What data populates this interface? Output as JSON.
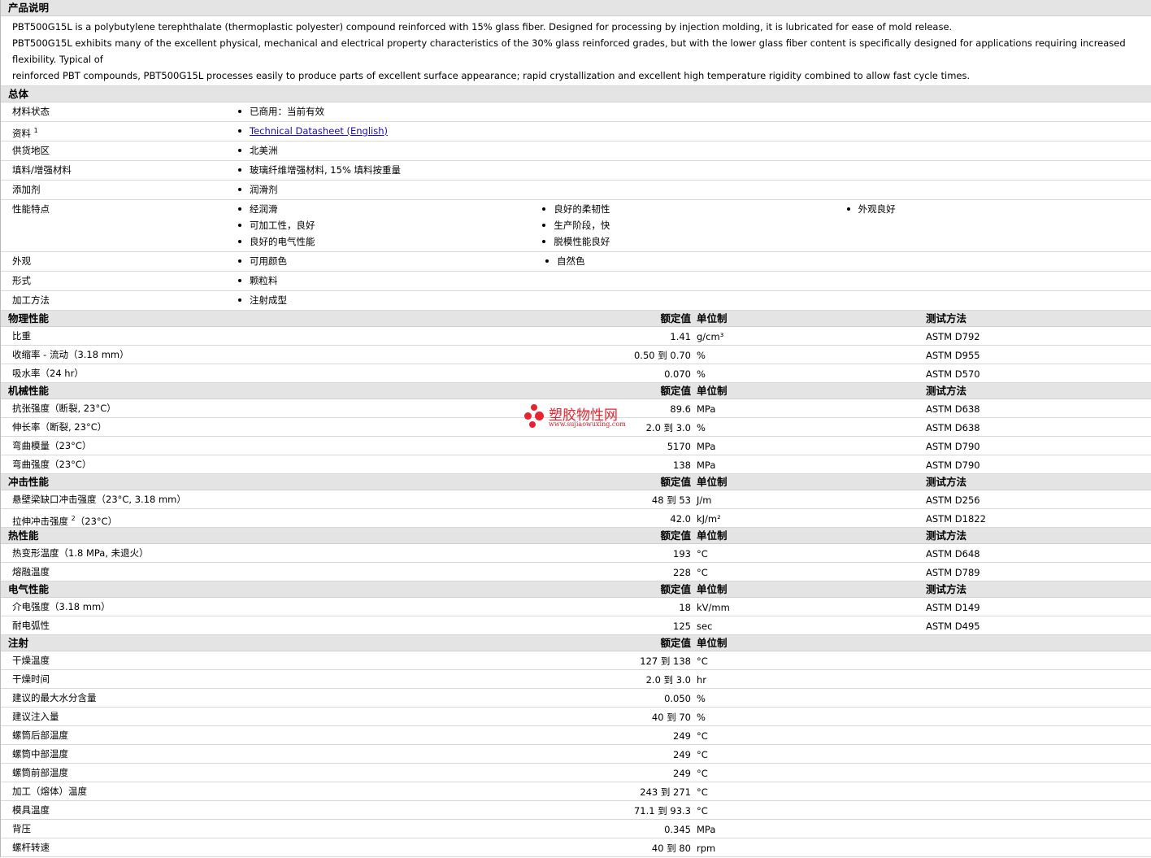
{
  "desc": {
    "title": "产品说明",
    "lines": [
      "PBT500G15L is a polybutylene terephthalate (thermoplastic polyester) compound reinforced with 15% glass fiber. Designed for processing by injection molding, it is lubricated for ease of mold release.",
      "PBT500G15L exhibits many of the excellent physical, mechanical and electrical property characteristics of the 30% glass reinforced grades, but with the lower glass fiber content is specifically designed for applications requiring increased flexibility. Typical of",
      "reinforced PBT compounds, PBT500G15L processes easily to produce parts of excellent surface appearance; rapid crystallization and excellent high temperature rigidity combined to allow fast cycle times."
    ]
  },
  "general": {
    "title": "总体",
    "rows": [
      {
        "label": "材料状态",
        "cols": [
          [
            "已商用：当前有效"
          ]
        ]
      },
      {
        "label": "资料",
        "sup": "1",
        "link": "Technical Datasheet (English)"
      },
      {
        "label": "供货地区",
        "cols": [
          [
            "北美洲"
          ]
        ]
      },
      {
        "label": "填料/增强材料",
        "cols": [
          [
            "玻璃纤维增强材料, 15% 填料按重量"
          ]
        ]
      },
      {
        "label": "添加剂",
        "cols": [
          [
            "润滑剂"
          ]
        ]
      },
      {
        "label": "性能特点",
        "cols": [
          [
            "经润滑",
            "可加工性，良好",
            "良好的电气性能"
          ],
          [
            "良好的柔韧性",
            "生产阶段，快",
            "脱模性能良好"
          ],
          [
            "外观良好"
          ]
        ]
      },
      {
        "label": "外观",
        "cols": [
          [
            "可用颜色"
          ],
          [
            "自然色"
          ]
        ]
      },
      {
        "label": "形式",
        "cols": [
          [
            "颗粒料"
          ]
        ]
      },
      {
        "label": "加工方法",
        "cols": [
          [
            "注射成型"
          ]
        ]
      }
    ]
  },
  "headers": {
    "value": "额定值",
    "unit": "单位制",
    "test": "测试方法"
  },
  "sections": [
    {
      "title": "物理性能",
      "showTest": true,
      "rows": [
        {
          "label": "比重",
          "value": "1.41",
          "unit": "g/cm³",
          "test": "ASTM D792"
        },
        {
          "label": "收缩率 - 流动（3.18 mm）",
          "value": "0.50 到  0.70",
          "unit": "%",
          "test": "ASTM D955"
        },
        {
          "label": "吸水率（24 hr）",
          "value": "0.070",
          "unit": "%",
          "test": "ASTM D570"
        }
      ]
    },
    {
      "title": "机械性能",
      "showTest": true,
      "rows": [
        {
          "label": "抗张强度（断裂, 23°C）",
          "value": "89.6",
          "unit": "MPa",
          "test": "ASTM D638"
        },
        {
          "label": "伸长率（断裂, 23°C）",
          "value": "2.0 到  3.0",
          "unit": "%",
          "test": "ASTM D638"
        },
        {
          "label": "弯曲模量（23°C）",
          "value": "5170",
          "unit": "MPa",
          "test": "ASTM D790"
        },
        {
          "label": "弯曲强度（23°C）",
          "value": "138",
          "unit": "MPa",
          "test": "ASTM D790"
        }
      ]
    },
    {
      "title": "冲击性能",
      "showTest": true,
      "rows": [
        {
          "label": "悬壁梁缺口冲击强度（23°C, 3.18 mm）",
          "value": "48 到  53",
          "unit": "J/m",
          "test": "ASTM D256"
        },
        {
          "label": "拉伸冲击强度",
          "sup": "2",
          "labelTail": "（23°C）",
          "value": "42.0",
          "unit": "kJ/m²",
          "test": "ASTM D1822"
        }
      ]
    },
    {
      "title": "热性能",
      "showTest": true,
      "rows": [
        {
          "label": "热变形温度（1.8 MPa, 未退火）",
          "value": "193",
          "unit": "°C",
          "test": "ASTM D648"
        },
        {
          "label": "熔融温度",
          "value": "228",
          "unit": "°C",
          "test": "ASTM D789"
        }
      ]
    },
    {
      "title": "电气性能",
      "showTest": true,
      "rows": [
        {
          "label": "介电强度（3.18 mm）",
          "value": "18",
          "unit": "kV/mm",
          "test": "ASTM D149"
        },
        {
          "label": "耐电弧性",
          "value": "125",
          "unit": "sec",
          "test": "ASTM D495"
        }
      ]
    },
    {
      "title": "注射",
      "showTest": false,
      "rows": [
        {
          "label": "干燥温度",
          "value": "127 到  138",
          "unit": "°C",
          "test": ""
        },
        {
          "label": "干燥时间",
          "value": "2.0 到  3.0",
          "unit": "hr",
          "test": ""
        },
        {
          "label": "建议的最大水分含量",
          "value": "0.050",
          "unit": "%",
          "test": ""
        },
        {
          "label": "建议注入量",
          "value": "40 到  70",
          "unit": "%",
          "test": ""
        },
        {
          "label": "螺筒后部温度",
          "value": "249",
          "unit": "°C",
          "test": ""
        },
        {
          "label": "螺筒中部温度",
          "value": "249",
          "unit": "°C",
          "test": ""
        },
        {
          "label": "螺筒前部温度",
          "value": "249",
          "unit": "°C",
          "test": ""
        },
        {
          "label": "加工（熔体）温度",
          "value": "243 到  271",
          "unit": "°C",
          "test": ""
        },
        {
          "label": "模具温度",
          "value": "71.1 到  93.3",
          "unit": "°C",
          "test": ""
        },
        {
          "label": "背压",
          "value": "0.345",
          "unit": "MPa",
          "test": ""
        },
        {
          "label": "螺杆转速",
          "value": "40 到  80",
          "unit": "rpm",
          "test": ""
        }
      ]
    }
  ],
  "watermark": {
    "text": "塑胶物性网",
    "url": "www.sujiaowuxing.com",
    "color": "#e8222e"
  }
}
